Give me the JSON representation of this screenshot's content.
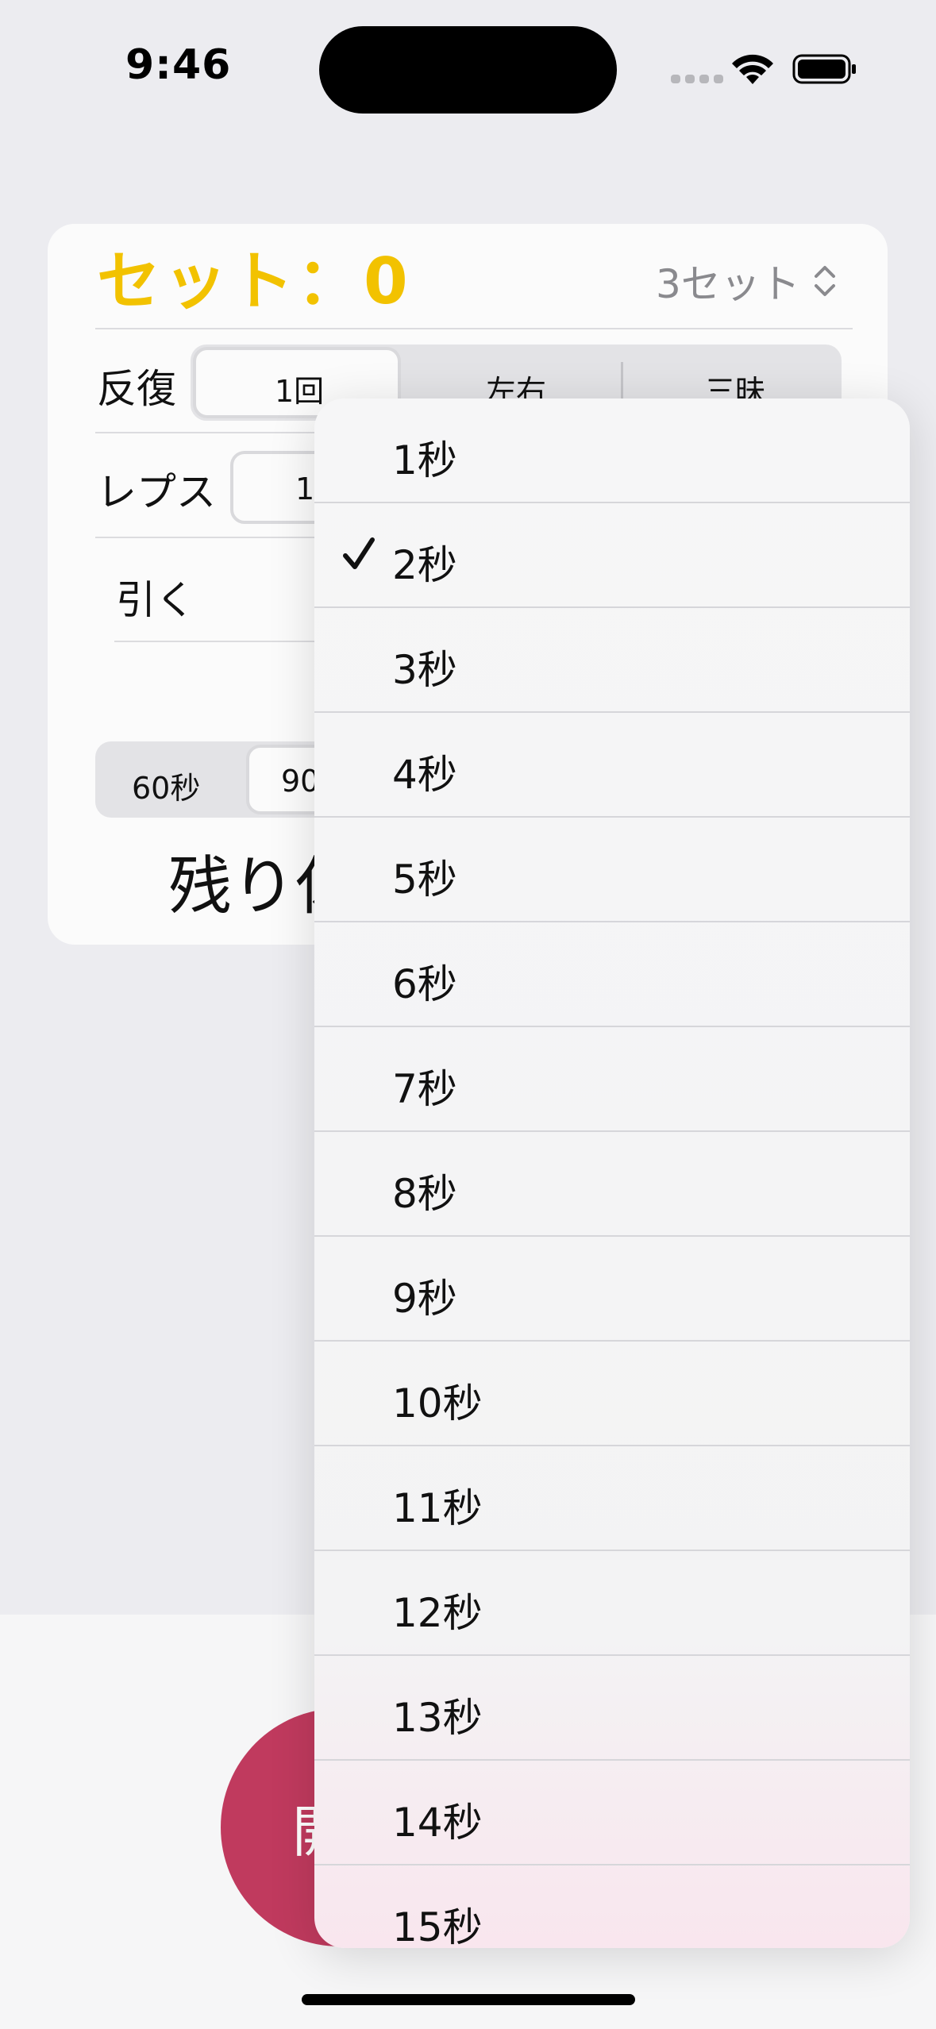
{
  "status_bar": {
    "time": "9:46"
  },
  "card": {
    "sets_title": "セット：0",
    "sets_picker_value": "3セット",
    "rows": [
      {
        "label": "反復",
        "segments": [
          "1回",
          "左右",
          "三昧"
        ],
        "selected_index": 0
      },
      {
        "label": "レプス",
        "partial_segment": "10"
      },
      {
        "label": "引く"
      }
    ],
    "rest_segments": [
      "60秒",
      "90"
    ],
    "remaining_label": "残り休"
  },
  "start_button": {
    "label": "開"
  },
  "menu": {
    "items": [
      "1秒",
      "2秒",
      "3秒",
      "4秒",
      "5秒",
      "6秒",
      "7秒",
      "8秒",
      "9秒",
      "10秒",
      "11秒",
      "12秒",
      "13秒",
      "14秒",
      "15秒"
    ],
    "selected_index": 1
  },
  "colors": {
    "accent": "#f2c200",
    "start_button": "#c03a5e"
  }
}
